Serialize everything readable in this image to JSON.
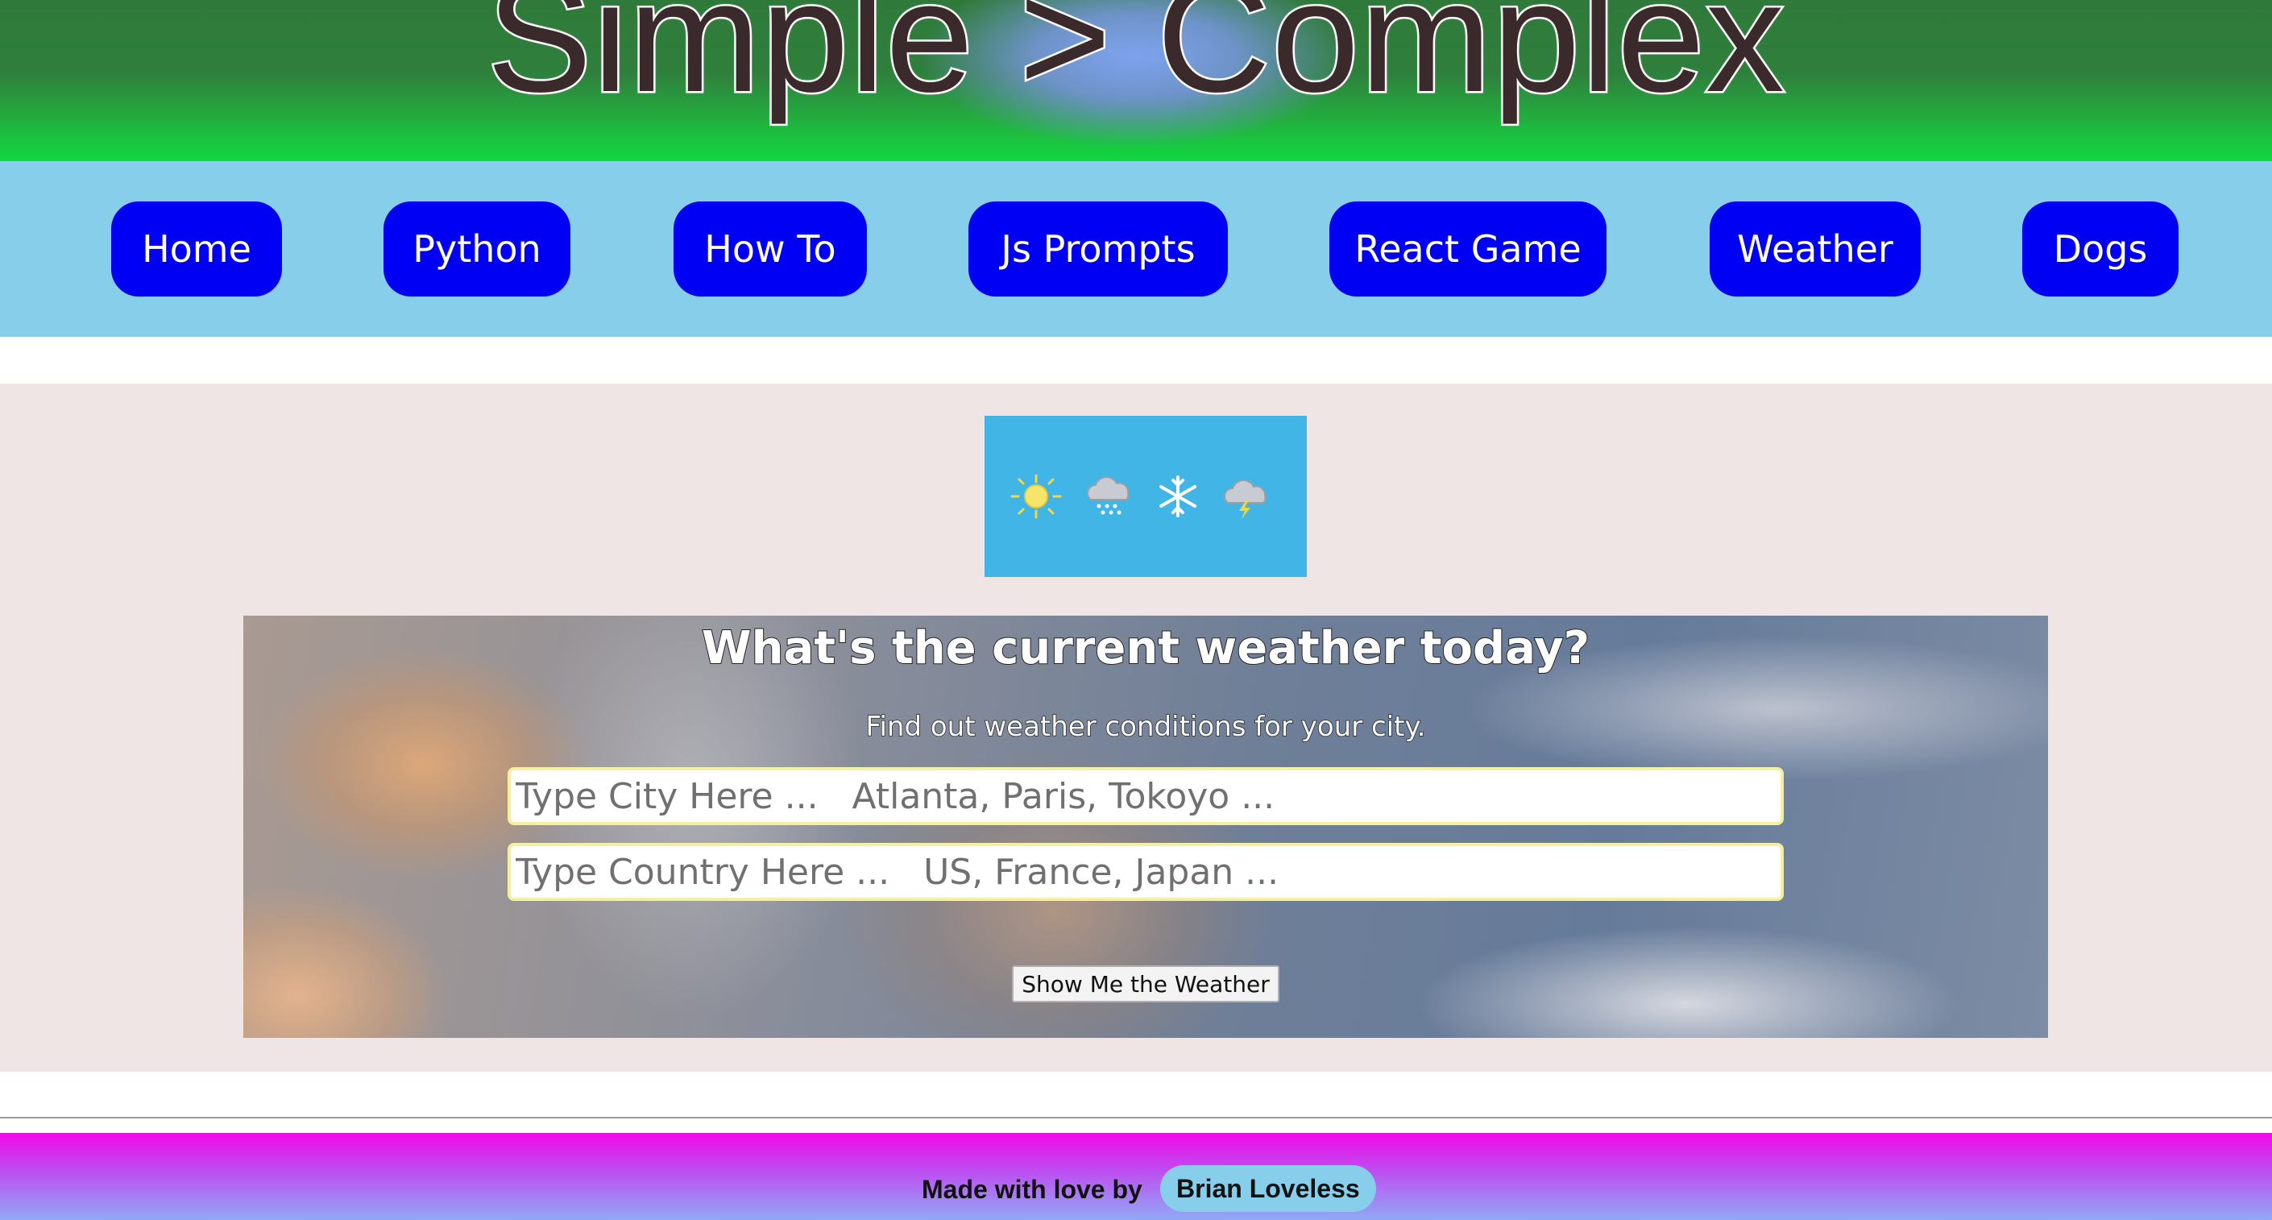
{
  "header": {
    "title": "Simple > Complex"
  },
  "nav": {
    "items": [
      {
        "label": "Home"
      },
      {
        "label": "Python"
      },
      {
        "label": "How To"
      },
      {
        "label": "Js Prompts"
      },
      {
        "label": "React Game"
      },
      {
        "label": "Weather"
      },
      {
        "label": "Dogs"
      }
    ]
  },
  "weather_icons": {
    "icons": [
      "sun-icon",
      "snow-cloud-icon",
      "snowflake-icon",
      "thunder-cloud-icon"
    ]
  },
  "weather_card": {
    "title": "What's the current weather today?",
    "subtitle": "Find out weather conditions for your city.",
    "city_placeholder": "Type City Here ...   Atlanta, Paris, Tokoyo ...",
    "city_value": "",
    "country_placeholder": "Type Country Here ...   US, France, Japan ...",
    "country_value": "",
    "submit_label": "Show Me the Weather"
  },
  "footer": {
    "made_with": "Made with love by",
    "author": "Brian Loveless"
  },
  "colors": {
    "nav_bg": "#87ceeb",
    "nav_button": "#0000f5",
    "main_bg": "#eee5e4",
    "icon_strip": "#41b5e6"
  }
}
